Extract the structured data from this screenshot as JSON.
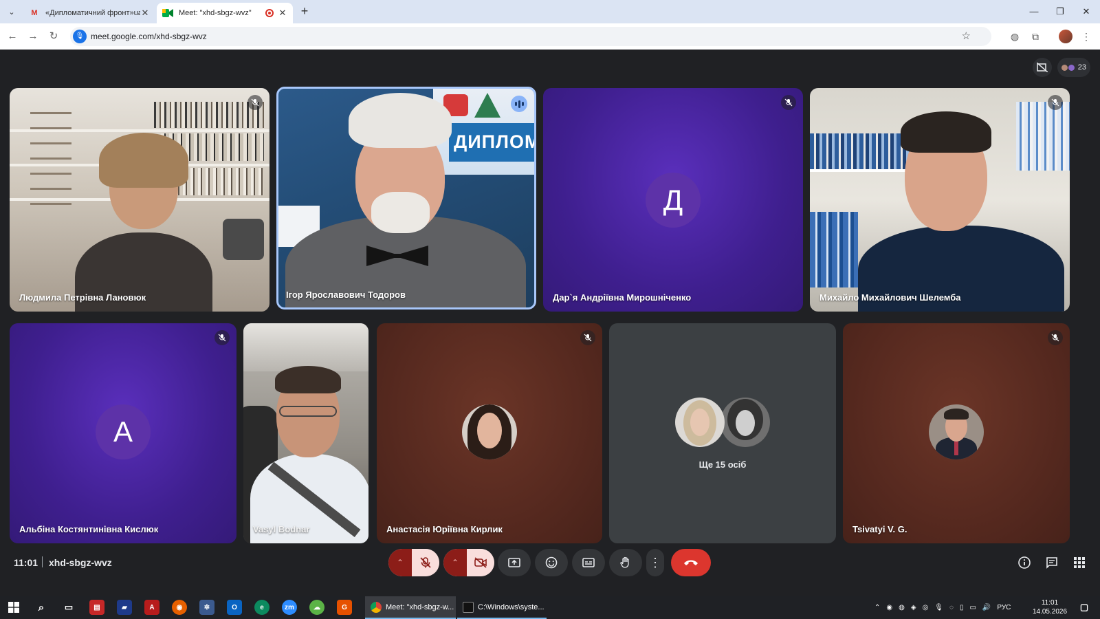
{
  "browser": {
    "tabs": [
      {
        "title": "«Дипломатичний фронт»ua - I",
        "favicon": "gmail-icon",
        "active": false
      },
      {
        "title": "Meet: \"xhd-sbgz-wvz\"",
        "favicon": "meet-icon",
        "active": true,
        "recording": true
      }
    ],
    "url": "meet.google.com/xhd-sbgz-wvz"
  },
  "meet": {
    "participant_count": "23",
    "tiles": [
      {
        "name": "Людмила Петрівна Лановюк",
        "muted": true,
        "video": true
      },
      {
        "name": "Ігор Ярославович Тодоров",
        "muted": false,
        "video": true,
        "speaking": true,
        "banner_text": "ДИПЛОМА"
      },
      {
        "name": "Дар`я Андріївна Мирошніченко",
        "muted": true,
        "video": false,
        "initial": "Д"
      },
      {
        "name": "Михайло Михайлович Шелемба",
        "muted": true,
        "video": true
      },
      {
        "name": "Альбіна Костянтинівна Кислюк",
        "muted": true,
        "video": false,
        "initial": "А"
      },
      {
        "name": "Vasyl Bodnar",
        "muted": false,
        "video": true
      },
      {
        "name": "Анастасія Юріївна Кирлик",
        "muted": true,
        "video": false
      },
      {
        "name": "Ще 15 осіб",
        "muted": false,
        "video": false
      },
      {
        "name": "Tsivatyi V. G.",
        "muted": true,
        "video": false
      }
    ],
    "time": "11:01",
    "meeting_code": "xhd-sbgz-wvz",
    "colors": {
      "leave": "#dc362e",
      "active_speaker_border": "#a8c7fa",
      "purple_tile": "#3f1f8f",
      "brown_tile": "#56291f"
    }
  },
  "taskbar": {
    "apps": [
      {
        "label": "Meet: \"xhd-sbgz-w...",
        "icon": "chrome-icon",
        "active": true
      },
      {
        "label": "C:\\Windows\\syste...",
        "icon": "cmd-icon",
        "active": false
      }
    ],
    "language": "РУС",
    "time": "11:01",
    "date": "14.05.2026"
  }
}
